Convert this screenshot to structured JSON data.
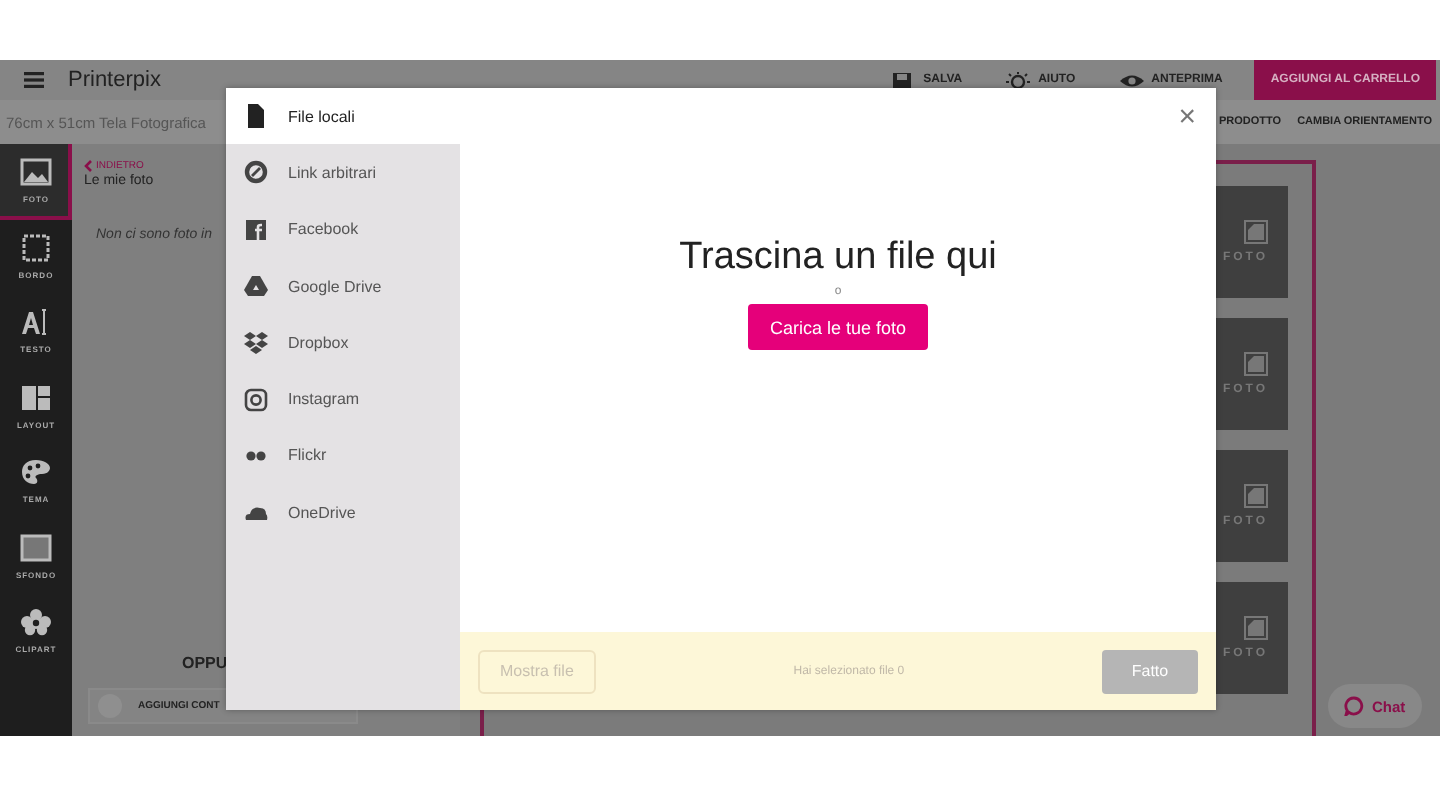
{
  "app": {
    "brand": "Printerpix",
    "toolbar": [
      {
        "kind": "save",
        "label": "SALVA"
      },
      {
        "kind": "help",
        "label": "AIUTO"
      },
      {
        "kind": "preview",
        "label": "ANTEPRIMA"
      }
    ],
    "cart_button": "AGGIUNGI AL CARRELLO",
    "product_title": "76cm x 51cm Tela Fotografica",
    "product_actions": [
      "PRODOTTO",
      "CAMBIA ORIENTAMENTO"
    ],
    "sidebar": [
      {
        "kind": "photo",
        "label": "FOTO",
        "selected": true
      },
      {
        "kind": "border",
        "label": "BORDO",
        "selected": false
      },
      {
        "kind": "text",
        "label": "TESTO",
        "selected": false
      },
      {
        "kind": "layout",
        "label": "LAYOUT",
        "selected": false
      },
      {
        "kind": "theme",
        "label": "TEMA",
        "selected": false
      },
      {
        "kind": "background",
        "label": "SFONDO",
        "selected": false
      },
      {
        "kind": "clipart",
        "label": "CLIPART",
        "selected": false
      }
    ],
    "panel": {
      "back": "INDIETRO",
      "title": "Le mie foto",
      "empty_message": "Non ci sono foto in",
      "or_label": "OPPU",
      "add_button": "AGGIUNGI CONT"
    },
    "canvas": {
      "tiles": [
        "FOTO",
        "FOTO",
        "FOTO",
        "FOTO"
      ]
    },
    "chat_button": "Chat"
  },
  "dialog": {
    "sources": [
      {
        "kind": "file",
        "label": "File locali",
        "selected": true
      },
      {
        "kind": "link",
        "label": "Link arbitrari",
        "selected": false
      },
      {
        "kind": "facebook",
        "label": "Facebook",
        "selected": false
      },
      {
        "kind": "drive",
        "label": "Google Drive",
        "selected": false
      },
      {
        "kind": "dropbox",
        "label": "Dropbox",
        "selected": false
      },
      {
        "kind": "instagram",
        "label": "Instagram",
        "selected": false
      },
      {
        "kind": "flickr",
        "label": "Flickr",
        "selected": false
      },
      {
        "kind": "onedrive",
        "label": "OneDrive",
        "selected": false
      }
    ],
    "close": "×",
    "drop_title": "Trascina un file qui",
    "or_label": "o",
    "upload_button": "Carica le tue foto",
    "footer": {
      "show_files_button": "Mostra file",
      "status": "Hai selezionato file 0",
      "done_button": "Fatto"
    }
  }
}
